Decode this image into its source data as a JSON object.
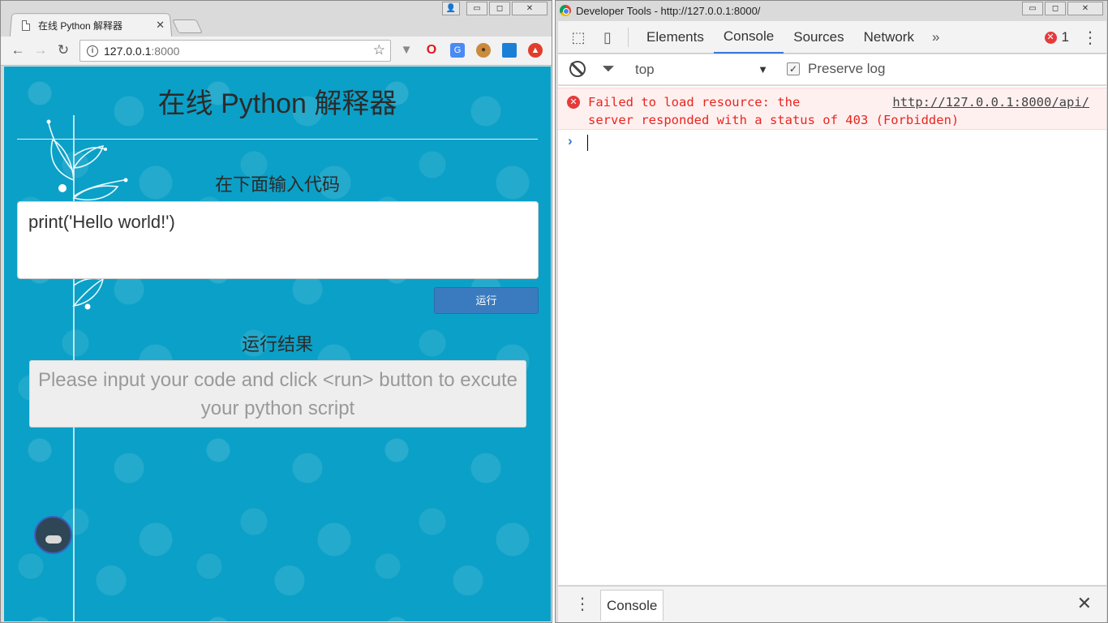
{
  "browser": {
    "tab_title": "在线 Python 解释器",
    "tab_close": "✕",
    "window_controls": {
      "user": "👤",
      "minimize": "▭",
      "maximize": "◻",
      "close": "✕"
    },
    "toolbar": {
      "back": "←",
      "forward": "→",
      "reload": "↻",
      "star": "☆"
    },
    "url": {
      "host": "127.0.0.1",
      "port": ":8000"
    },
    "extensions": [
      "v-extension-icon",
      "opera-icon",
      "translate-icon",
      "cookie-icon",
      "window-icon",
      "upload-icon"
    ]
  },
  "page": {
    "title": "在线 Python 解释器",
    "input_heading": "在下面输入代码",
    "code": "print('Hello world!')",
    "run_label": "运行",
    "result_heading": "运行结果",
    "result_placeholder": "Please input your code and click <run> button to excute your python script",
    "bg_color": "#0ba0c7",
    "run_color": "#3a7bbf"
  },
  "devtools": {
    "window_title": "Developer Tools - http://127.0.0.1:8000/",
    "tabs": [
      "Elements",
      "Console",
      "Sources",
      "Network"
    ],
    "active_tab": "Console",
    "more": "»",
    "error_count": "1",
    "context": "top",
    "preserve_log": "Preserve log",
    "preserve_log_checked": true,
    "console": {
      "error_line1": "Failed to load resource: the",
      "error_line2": "server responded with a status of 403 (Forbidden)",
      "error_link": "http://127.0.0.1:8000/api/",
      "error_color": "#e8261e"
    },
    "drawer_tab": "Console"
  }
}
